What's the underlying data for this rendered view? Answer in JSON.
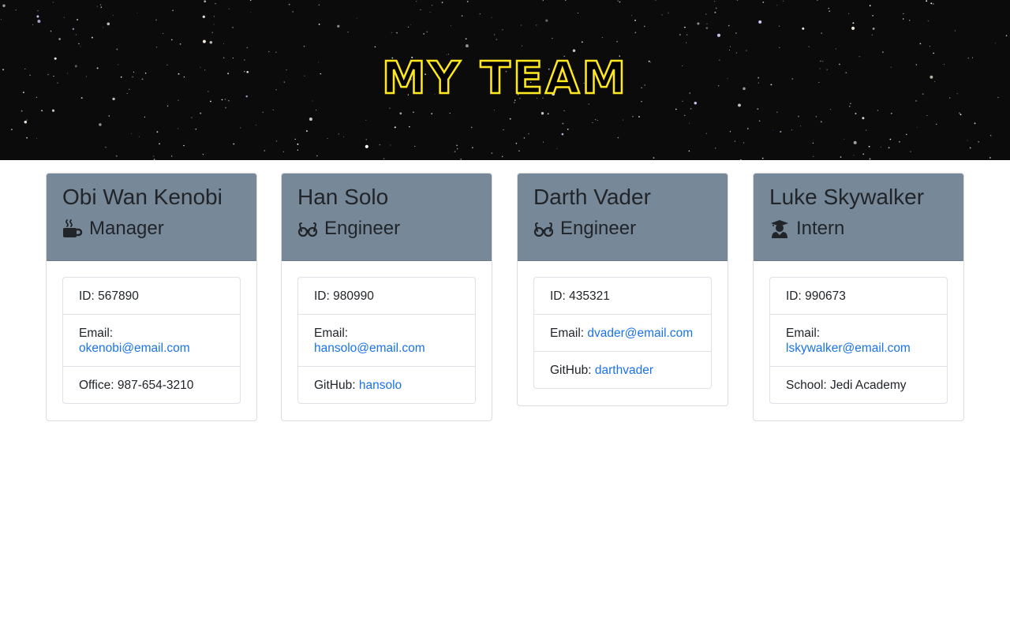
{
  "header": {
    "title": "MY TEAM"
  },
  "colors": {
    "hero_background": "#0b0b0c",
    "title_outline": "#ffe81f",
    "card_header": "#778899",
    "link": "#1a73e8"
  },
  "team": [
    {
      "name": "Obi Wan Kenobi",
      "role": "Manager",
      "role_icon": "mug-icon",
      "id_label": "ID:",
      "id": "567890",
      "email_label": "Email:",
      "email": "okenobi@email.com",
      "extra_label": "Office:",
      "extra": "987-654-3210"
    },
    {
      "name": "Han Solo",
      "role": "Engineer",
      "role_icon": "glasses-icon",
      "id_label": "ID:",
      "id": "980990",
      "email_label": "Email:",
      "email": "hansolo@email.com",
      "extra_label": "GitHub:",
      "extra": "hansolo"
    },
    {
      "name": "Darth Vader",
      "role": "Engineer",
      "role_icon": "glasses-icon",
      "id_label": "ID:",
      "id": "435321",
      "email_label": "Email:",
      "email": "dvader@email.com",
      "extra_label": "GitHub:",
      "extra": "darthvader"
    },
    {
      "name": "Luke Skywalker",
      "role": "Intern",
      "role_icon": "graduate-icon",
      "id_label": "ID:",
      "id": "990673",
      "email_label": "Email:",
      "email": "lskywalker@email.com",
      "extra_label": "School:",
      "extra": "Jedi Academy"
    }
  ]
}
